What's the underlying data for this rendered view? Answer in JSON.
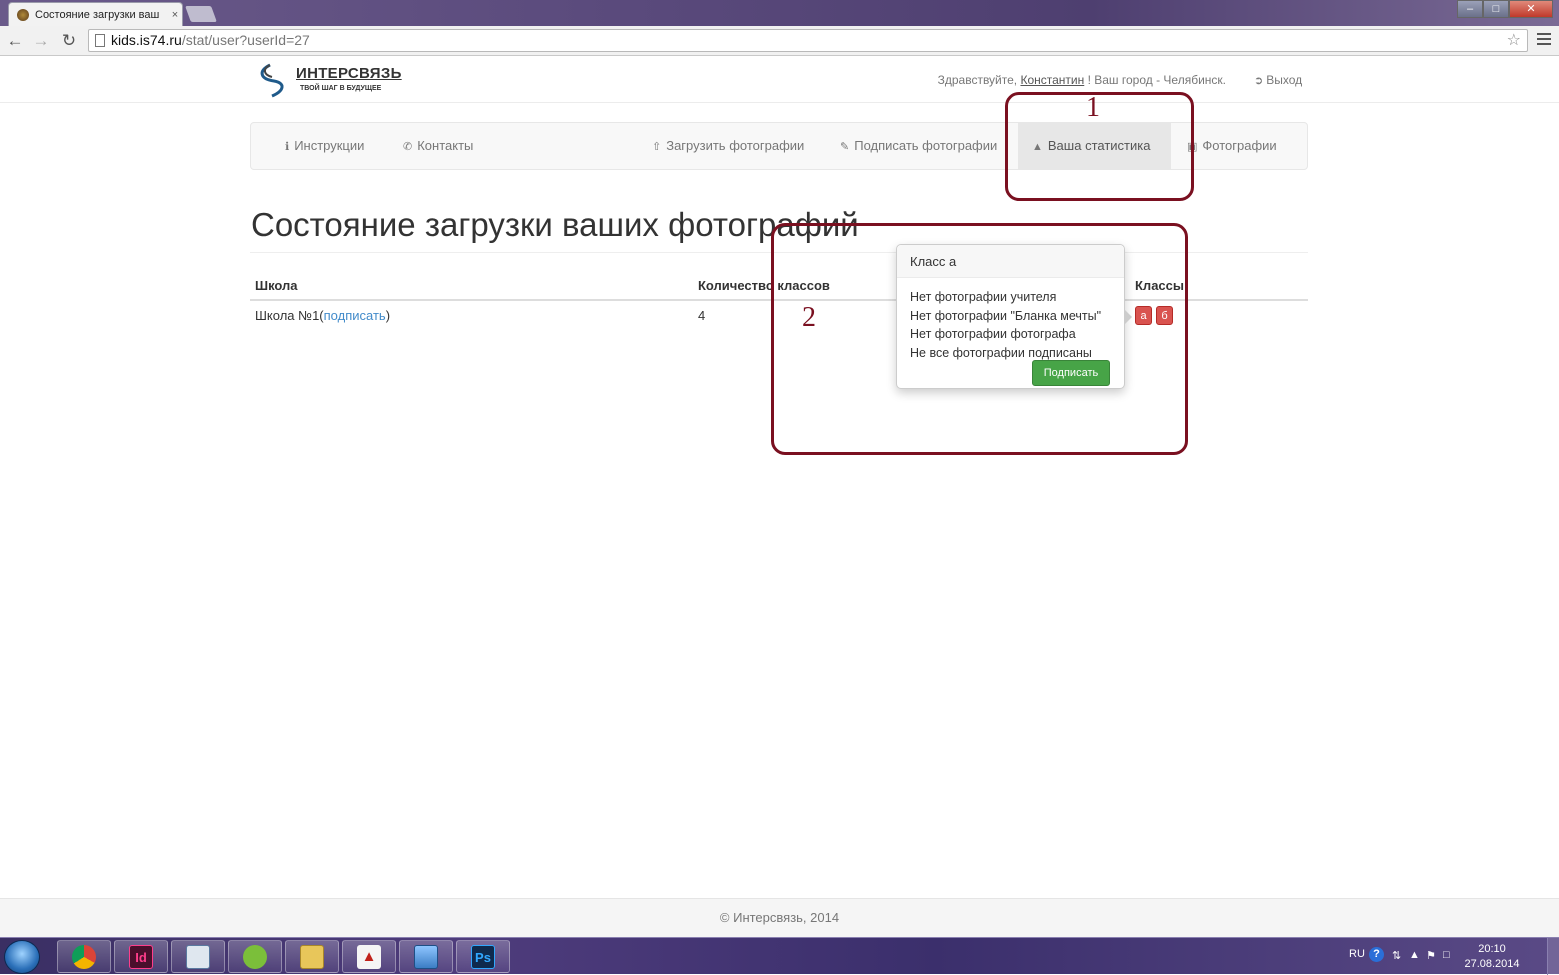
{
  "browser": {
    "tab_title": "Состояние загрузки ваш",
    "tab_close": "×",
    "url_host": "kids.is74.ru",
    "url_path": "/stat/user?userId=27",
    "back_icon": "back-arrow-icon",
    "forward_icon": "forward-arrow-icon",
    "reload_icon": "reload-icon",
    "star_icon": "star-icon",
    "menu_icon": "hamburger-menu-icon",
    "window_buttons": {
      "minimize": "–",
      "maximize": "□",
      "close": "✕"
    }
  },
  "header": {
    "logo_name": "ИНТЕРСВЯЗЬ",
    "logo_tagline": "ТВОЙ ШАГ В БУДУЩЕЕ",
    "greeting_prefix": "Здравствуйте, ",
    "user_name": "Константин",
    "greeting_suffix": " ! Ваш город - Челябинск.",
    "logout_label": "Выход"
  },
  "nav": {
    "items": [
      {
        "label": "Инструкции",
        "icon": "info-icon",
        "active": false
      },
      {
        "label": "Контакты",
        "icon": "phone-icon",
        "active": false
      },
      {
        "label": "Загрузить фотографии",
        "icon": "upload-icon",
        "active": false
      },
      {
        "label": "Подписать фотографии",
        "icon": "pencil-icon",
        "active": false
      },
      {
        "label": "Ваша статистика",
        "icon": "chart-icon",
        "active": true
      },
      {
        "label": "Фотографии",
        "icon": "picture-icon",
        "active": false
      }
    ]
  },
  "main": {
    "title": "Состояние загрузки ваших фотографий",
    "table": {
      "headers": [
        "Школа",
        "Количество классов",
        "Классы"
      ],
      "rows": [
        {
          "school": "Школа №1",
          "sign_link": "подписать",
          "class_count": "4",
          "classes": [
            "а",
            "б"
          ]
        }
      ]
    },
    "popover": {
      "title": "Класс а",
      "items": [
        "Нет фотографии учителя",
        "Нет фотографии \"Бланка мечты\"",
        "Нет фотографии фотографа",
        "Не все фотографии подписаны"
      ],
      "button": "Подписать"
    },
    "annotations": {
      "one": "1",
      "two": "2",
      "color": "#7a1020"
    }
  },
  "footer": {
    "text": "© Интерсвязь, 2014"
  },
  "taskbar": {
    "apps": [
      "chrome-icon",
      "indesign-icon",
      "explorer-window-icon",
      "corel-icon",
      "folder-icon",
      "acrobat-icon",
      "photo-viewer-icon",
      "photoshop-icon"
    ],
    "indesign_label": "Id",
    "photoshop_label": "Ps",
    "lang": "RU",
    "help": "?",
    "time": "20:10",
    "date": "27.08.2014"
  },
  "colors": {
    "accent_link": "#428bca",
    "danger": "#d9534f",
    "success": "#47a447"
  }
}
